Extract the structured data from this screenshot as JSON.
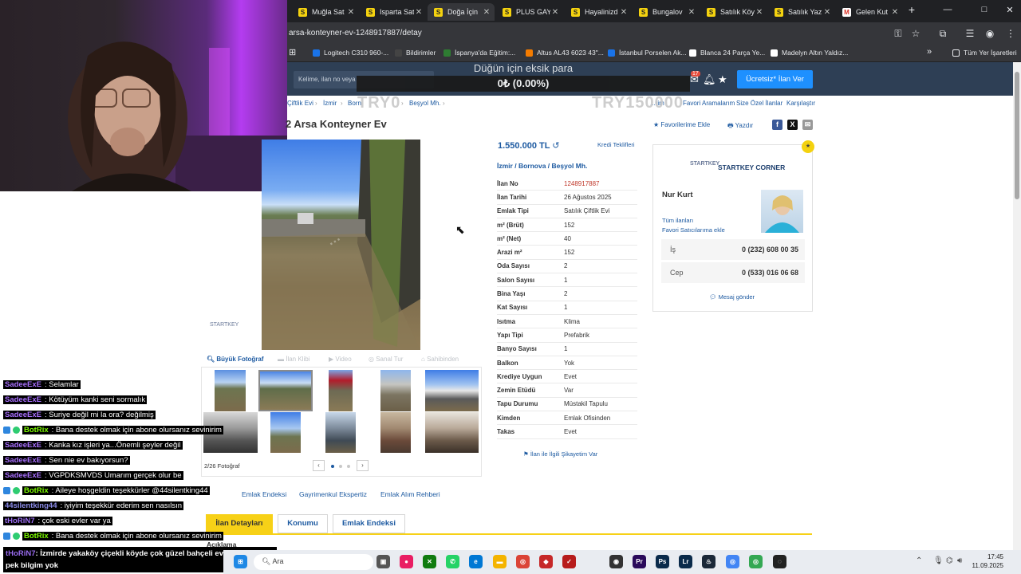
{
  "browser": {
    "tabs": [
      {
        "label": "Muğla Sat",
        "icon": "s-icon"
      },
      {
        "label": "Isparta Sat",
        "icon": "s-icon"
      },
      {
        "label": "Doğa İçin",
        "icon": "s-icon",
        "active": true
      },
      {
        "label": "PLUS GAYI",
        "icon": "s-icon"
      },
      {
        "label": "Hayalinizd",
        "icon": "s-icon"
      },
      {
        "label": "Bungalov",
        "icon": "s-icon"
      },
      {
        "label": "Satılık Köy",
        "icon": "s-icon"
      },
      {
        "label": "Satılık Yaz",
        "icon": "s-icon"
      },
      {
        "label": "Gelen Kut",
        "icon": "gmail-icon"
      }
    ],
    "new_tab": "+",
    "url": "arsa-konteyner-ev-1248917887/detay",
    "bookmarks": [
      {
        "label": "Logitech C310 960-...",
        "color": "#1a73e8"
      },
      {
        "label": "Bildirimler",
        "color": "#444444"
      },
      {
        "label": "İspanya'da Eğitim:...",
        "color": "#2e7d32"
      },
      {
        "label": "Altus AL43 6023 43\"...",
        "color": "#f57c00"
      },
      {
        "label": "İstanbul Porselen Ak...",
        "color": "#1a73e8"
      },
      {
        "label": "Blanca 24 Parça Ye...",
        "color": "#ffffff"
      },
      {
        "label": "Madelyn Altın Yaldız...",
        "color": "#ffffff"
      }
    ],
    "all_bookmarks": "Tüm Yer İşaretleri"
  },
  "site": {
    "search_placeholder": "Kelime, ilan no veya ",
    "donation_label": "Düğün için eksik para",
    "donation_value": "0₺ (0.00%)",
    "notification_count": "17",
    "post_ad_button": "Ücretsiz* İlan Ver",
    "overlay_left": "TRY0",
    "overlay_right": "TRY150000",
    "breadcrumb": [
      "Çiftlik Evi",
      "İzmir",
      "Born",
      "Beşyol Mh."
    ],
    "sub_links": [
      "Favori Aramalarım",
      "Size Özel İlanlar",
      "Karşılaştır"
    ],
    "sub_link_partial": "...rim"
  },
  "listing": {
    "title": "2 Arsa Konteyner Ev",
    "favorite": "Favorilerime Ekle",
    "print": "Yazdır",
    "price": "1.550.000 TL",
    "credit": "Kredi Teklifleri",
    "location": [
      "İzmir",
      "Bornova",
      "Beşyol Mh."
    ],
    "details": [
      {
        "k": "İlan No",
        "v": "1248917887",
        "red": true
      },
      {
        "k": "İlan Tarihi",
        "v": "26 Ağustos 2025"
      },
      {
        "k": "Emlak Tipi",
        "v": "Satılık Çiftlik Evi"
      },
      {
        "k": "m² (Brüt)",
        "v": "152"
      },
      {
        "k": "m² (Net)",
        "v": "40"
      },
      {
        "k": "Arazi m²",
        "v": "152"
      },
      {
        "k": "Oda Sayısı",
        "v": "2"
      },
      {
        "k": "Salon Sayısı",
        "v": "1"
      },
      {
        "k": "Bina Yaşı",
        "v": "2"
      },
      {
        "k": "Kat Sayısı",
        "v": "1"
      },
      {
        "k": "Isıtma",
        "v": "Klima"
      },
      {
        "k": "Yapı Tipi",
        "v": "Prefabrik"
      },
      {
        "k": "Banyo Sayısı",
        "v": "1"
      },
      {
        "k": "Balkon",
        "v": "Yok"
      },
      {
        "k": "Krediye Uygun",
        "v": "Evet"
      },
      {
        "k": "Zemin Etüdü",
        "v": "Var"
      },
      {
        "k": "Tapu Durumu",
        "v": "Müstakil Tapulu"
      },
      {
        "k": "Kimden",
        "v": "Emlak Ofisinden"
      },
      {
        "k": "Takas",
        "v": "Evet"
      }
    ],
    "complaint": "İlan ile İlgili Şikayetim Var",
    "photo_tools": [
      "Büyük Fotoğraf",
      "İlan Klibi",
      "Video",
      "Sanal Tur",
      "Sahibinden"
    ],
    "photo_count": "2/26 Fotoğraf",
    "side_logo": "STARTKEY"
  },
  "seller": {
    "company": "STARTKEY CORNER",
    "logo_text": "STARTKEY",
    "agent": "Nur Kurt",
    "all_ads": "Tüm ilanları",
    "fav_seller": "Favori Satıcılarıma ekle",
    "phones": [
      {
        "k": "İş",
        "v": "0 (232) 608 00 35"
      },
      {
        "k": "Cep",
        "v": "0 (533) 016 06 68"
      }
    ],
    "message": "Mesaj gönder"
  },
  "bottom": {
    "links": [
      "Emlak Endeksi",
      "Gayrimenkul Ekspertiz",
      "Emlak Alım Rehberi"
    ],
    "tabs": [
      "İlan Detayları",
      "Konumu",
      "Emlak Endeksi"
    ],
    "description_label": "Açıklama"
  },
  "chat": [
    {
      "user": "SadeeExE",
      "text": ": Selamlar",
      "color": "#a970ff",
      "badge": false
    },
    {
      "user": "SadeeExE",
      "text": ": Kötüyüm kanki seni sormalık",
      "color": "#a970ff",
      "badge": false
    },
    {
      "user": "SadeeExE",
      "text": ": Suriye değil mi la ora? değilmiş",
      "color": "#a970ff",
      "badge": false
    },
    {
      "user": "BotRix",
      "text": ": Bana destek olmak için abone olursanız sevinirim",
      "color": "#7cfc00",
      "badge": true
    },
    {
      "user": "SadeeExE",
      "text": ": Kanka kız işleri ya...Önemli şeyler değil",
      "color": "#a970ff",
      "badge": false
    },
    {
      "user": "SadeeExE",
      "text": ": Sen nie ev bakıyorsun?",
      "color": "#a970ff",
      "badge": false
    },
    {
      "user": "SadeeExE",
      "text": ": VGPDKSMVDS Umarım gerçek olur be",
      "color": "#a970ff",
      "badge": false
    },
    {
      "user": "BotRix",
      "text": ": Aileye hoşgeldin teşekkürler @44silentking44",
      "color": "#7cfc00",
      "badge": true
    },
    {
      "user": "44silentking44",
      "text": ": iyiyim teşekkür ederim sen nasılsın",
      "color": "#8a8ae6",
      "badge": false
    },
    {
      "user": "tHoRiN7",
      "text": ": çok eski evler var ya",
      "color": "#9a6cf0",
      "badge": false
    },
    {
      "user": "BotRix",
      "text": ": Bana destek olmak için abone olursanız sevinirim",
      "color": "#7cfc00",
      "badge": true
    }
  ],
  "chat_last": {
    "user": "tHoRiN7",
    "line1": ": İzmirde yakaköy çiçekli köyde çok güzel bahçeli evler varda fiyatı",
    "line2": "pek bilgim yok"
  },
  "taskbar": {
    "search": "Ara",
    "time": "17:45",
    "date": "11.09.2025"
  }
}
